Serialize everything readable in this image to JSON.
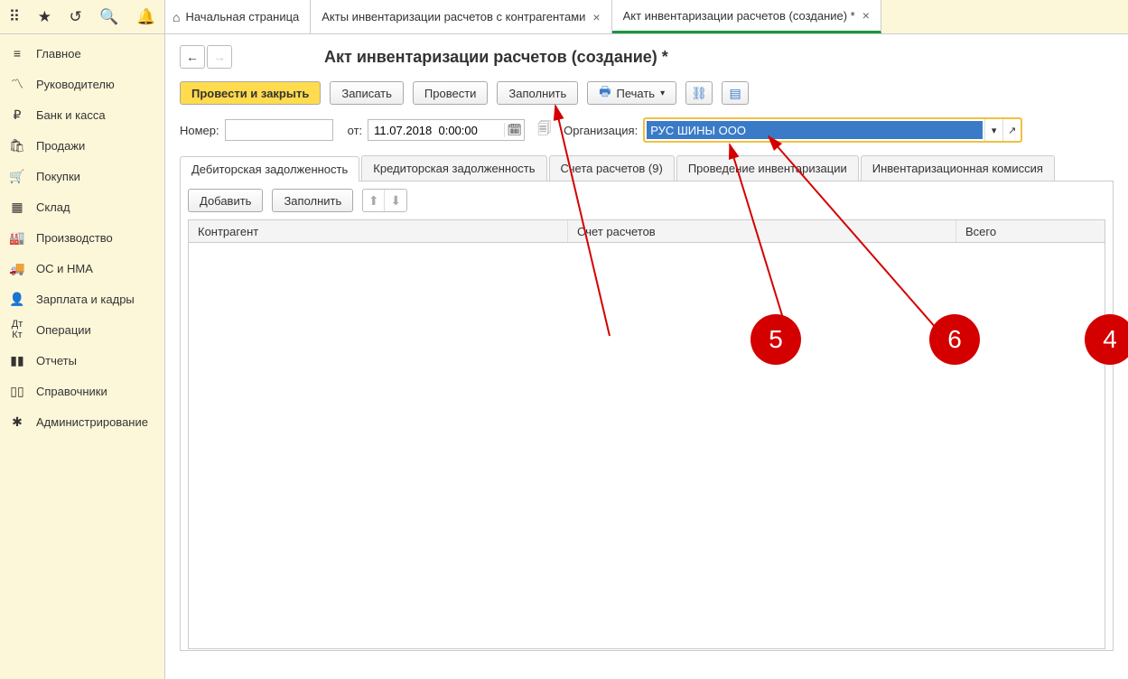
{
  "topbar_tabs": {
    "home": "Начальная страница",
    "tab1": "Акты инвентаризации расчетов с контрагентами",
    "tab2": "Акт инвентаризации расчетов (создание) *"
  },
  "sidebar": {
    "main": "Главное",
    "manager": "Руководителю",
    "bank": "Банк и касса",
    "sales": "Продажи",
    "purchases": "Покупки",
    "warehouse": "Склад",
    "production": "Производство",
    "os": "ОС и НМА",
    "salary": "Зарплата и кадры",
    "operations": "Операции",
    "reports": "Отчеты",
    "refs": "Справочники",
    "admin": "Администрирование"
  },
  "page": {
    "title": "Акт инвентаризации расчетов (создание) *"
  },
  "toolbar": {
    "post_close": "Провести и закрыть",
    "write": "Записать",
    "post": "Провести",
    "fill": "Заполнить",
    "print": "Печать"
  },
  "form": {
    "number_label": "Номер:",
    "number_value": "",
    "from_label": "от:",
    "date_value": "11.07.2018  0:00:00",
    "org_label": "Организация:",
    "org_value": "РУС ШИНЫ ООО"
  },
  "subtabs": {
    "debit": "Дебиторская задолженность",
    "credit": "Кредиторская задолженность",
    "accounts": "Счета расчетов (9)",
    "inventory": "Проведение инвентаризации",
    "commission": "Инвентаризационная комиссия"
  },
  "tabcontent": {
    "add": "Добавить",
    "fill": "Заполнить",
    "col1": "Контрагент",
    "col2": "Счет расчетов",
    "col3": "Всего"
  },
  "annotations": {
    "a4": "4",
    "a5": "5",
    "a6": "6"
  }
}
